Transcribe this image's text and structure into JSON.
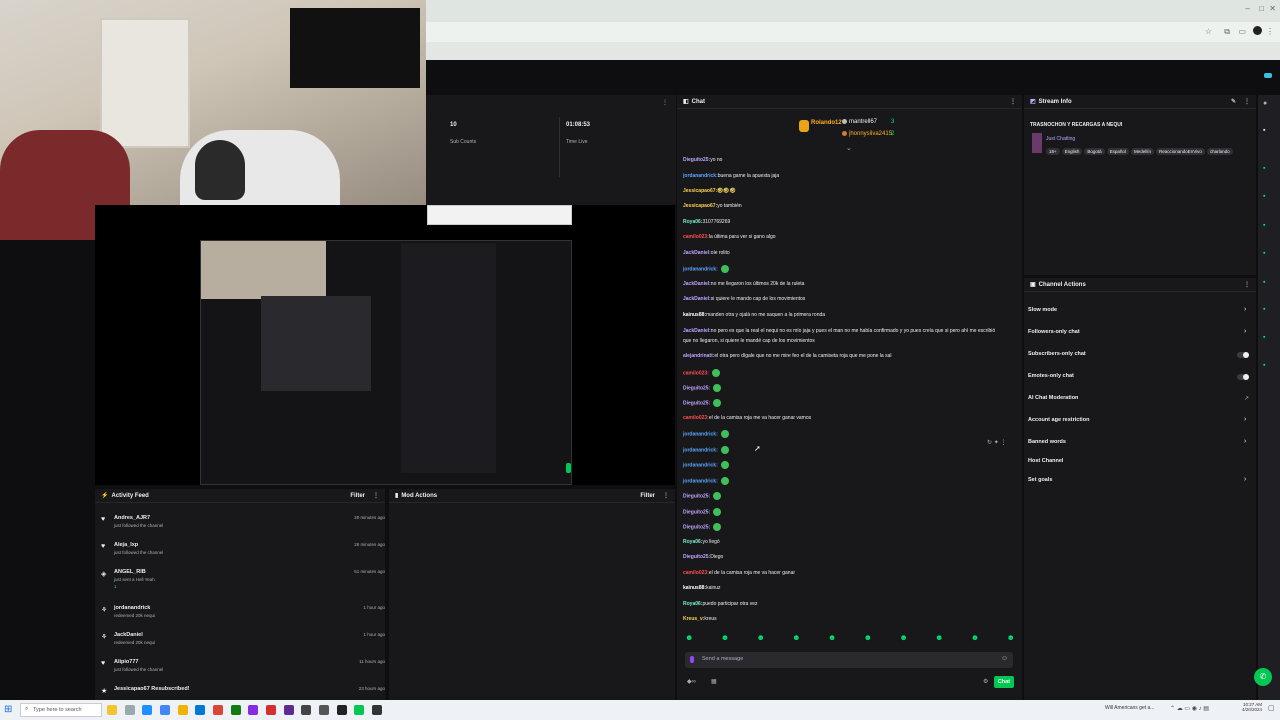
{
  "header": {
    "sub_count_value": "10",
    "sub_count_label": "Sub Counts",
    "time_live_value": "01:08:53",
    "time_live_label": "Time Live"
  },
  "chat": {
    "title": "Chat",
    "leaderboard": [
      {
        "name": "Rolando12"
      },
      {
        "name": "mantrell67",
        "value": "3"
      },
      {
        "name": "jhonnysilva2415",
        "value": "2"
      }
    ],
    "messages": [
      {
        "user": "Dieguito25:",
        "text": "yo no",
        "color": "#bfa6ff"
      },
      {
        "user": "jordanandrick:",
        "text": "buena game la apuesta jaja",
        "color": "#5aa7ff"
      },
      {
        "user": "Jessicapao67:",
        "text": "🤣🤣🤣",
        "color": "#ffd34d"
      },
      {
        "user": "Jessicapao67:",
        "text": "yo también",
        "color": "#ffd34d"
      },
      {
        "user": "Roya06:",
        "text": "3107769269",
        "color": "#7ef0c8"
      },
      {
        "user": "camilo023:",
        "text": "la última para ver si gano algo",
        "color": "#ff4d4d"
      },
      {
        "user": "JackDaniel:",
        "text": "ole rolito",
        "color": "#bfa6ff"
      },
      {
        "user": "jordanandrick:",
        "text": "",
        "color": "#5aa7ff"
      },
      {
        "user": "JackDaniel:",
        "text": "no me llegaron los últimos 20k de la ruleta",
        "color": "#bfa6ff"
      },
      {
        "user": "JackDaniel:",
        "text": "si quiere le mando cap de los movimientos",
        "color": "#bfa6ff"
      },
      {
        "user": "kainus88:",
        "text": "manden otra y ojalá no me saquen a la primera ronda",
        "color": "#ffffff"
      },
      {
        "user": "JackDaniel:",
        "text": "no pero es que la real el nequi no es mío jaja y pues el man no me había confirmado y yo pues creía que si pero ahí me escribió",
        "color": "#bfa6ff"
      },
      {
        "user": "",
        "text": "que no llegaron, si quiere le mandé cap de los movimientos",
        "color": "#bfa6ff"
      },
      {
        "user": "alejandrinatt:",
        "text": "el otra pero dígale que no me mire feo el de la camiseta roja que me pone la sal",
        "color": "#bfa6ff"
      },
      {
        "user": "camilo023:",
        "text": "",
        "color": "#ff4d4d"
      },
      {
        "user": "Dieguito25:",
        "text": "",
        "color": "#bfa6ff"
      },
      {
        "user": "Dieguito25:",
        "text": "",
        "color": "#bfa6ff"
      },
      {
        "user": "camilo023:",
        "text": "el de la camisa roja me va hacer ganar vamos",
        "color": "#ff4d4d"
      },
      {
        "user": "jordanandrick:",
        "text": "",
        "color": "#5aa7ff"
      },
      {
        "user": "jordanandrick:",
        "text": "",
        "color": "#5aa7ff"
      },
      {
        "user": "jordanandrick:",
        "text": "",
        "color": "#5aa7ff"
      },
      {
        "user": "jordanandrick:",
        "text": "",
        "color": "#5aa7ff"
      },
      {
        "user": "Dieguito25:",
        "text": "",
        "color": "#bfa6ff"
      },
      {
        "user": "Dieguito25:",
        "text": "",
        "color": "#bfa6ff"
      },
      {
        "user": "Dieguito25:",
        "text": "",
        "color": "#bfa6ff"
      },
      {
        "user": "Roya06:",
        "text": "yo llegó",
        "color": "#7ef0c8"
      },
      {
        "user": "Dieguito25:",
        "text": "Diego",
        "color": "#bfa6ff"
      },
      {
        "user": "camilo023:",
        "text": "el de la camisa roja me va hacer ganar",
        "color": "#ff4d4d"
      },
      {
        "user": "kainus88:",
        "text": "kainuz",
        "color": "#ffffff"
      },
      {
        "user": "Roya06:",
        "text": "puedo participar otra vez",
        "color": "#7ef0c8"
      },
      {
        "user": "Kreus_v:",
        "text": "kreus",
        "color": "#ffd34d"
      }
    ],
    "input_placeholder": "Send a message",
    "chat_button": "Chat"
  },
  "stream_info": {
    "title": "Stream Info",
    "stream_title": "TRASNOCHON Y RECARGAS A NEQUI",
    "category": "Just Chatting",
    "tags": [
      "18+",
      "English",
      "Bogotá",
      "Español",
      "Medellín",
      "ReaccionandoEnVivo",
      "charlando"
    ]
  },
  "channel_actions": {
    "title": "Channel Actions",
    "items": [
      {
        "label": "Slow mode",
        "control": "arrow"
      },
      {
        "label": "Followers-only chat",
        "control": "arrow"
      },
      {
        "label": "Subscribers-only chat",
        "control": "toggle"
      },
      {
        "label": "Emotes-only chat",
        "control": "toggle"
      },
      {
        "label": "AI Chat Moderation",
        "control": "link"
      },
      {
        "label": "Account age restriction",
        "control": "arrow"
      },
      {
        "label": "Banned words",
        "control": "arrow"
      },
      {
        "label": "Host Channel",
        "control": "none"
      },
      {
        "label": "Set goals",
        "control": "arrow"
      }
    ]
  },
  "activity": {
    "title": "Activity Feed",
    "filter": "Filter",
    "items": [
      {
        "name": "Andres_AJR7",
        "desc": "just followed the channel",
        "time": "20 minutes ago",
        "icon": "heart"
      },
      {
        "name": "Aleja_lxp",
        "desc": "just followed the channel",
        "time": "26 minutes ago",
        "icon": "heart"
      },
      {
        "name": "ANGEL_RIB",
        "desc": "just sent a Hell Yeah",
        "extra": "1",
        "time": "51 minutes ago",
        "icon": "bits"
      },
      {
        "name": "jordanandrick",
        "desc": "redeemed 20k nequi",
        "time": "1 hour ago",
        "icon": "reward"
      },
      {
        "name": "JackDaniel",
        "desc": "redeemed 20k nequi",
        "time": "1 hour ago",
        "icon": "reward"
      },
      {
        "name": "Alipio777",
        "desc": "just followed the channel",
        "time": "11 hours ago",
        "icon": "heart"
      },
      {
        "name": "Jessicapao67 Resubscribed!",
        "desc": "",
        "time": "23 hours ago",
        "icon": "star"
      }
    ]
  },
  "mod_actions": {
    "title": "Mod Actions",
    "filter": "Filter"
  },
  "taskbar": {
    "search_placeholder": "Type here to search",
    "news": "Will Americans get a...",
    "time": "10:27 AM",
    "date": "4/20/2024"
  }
}
